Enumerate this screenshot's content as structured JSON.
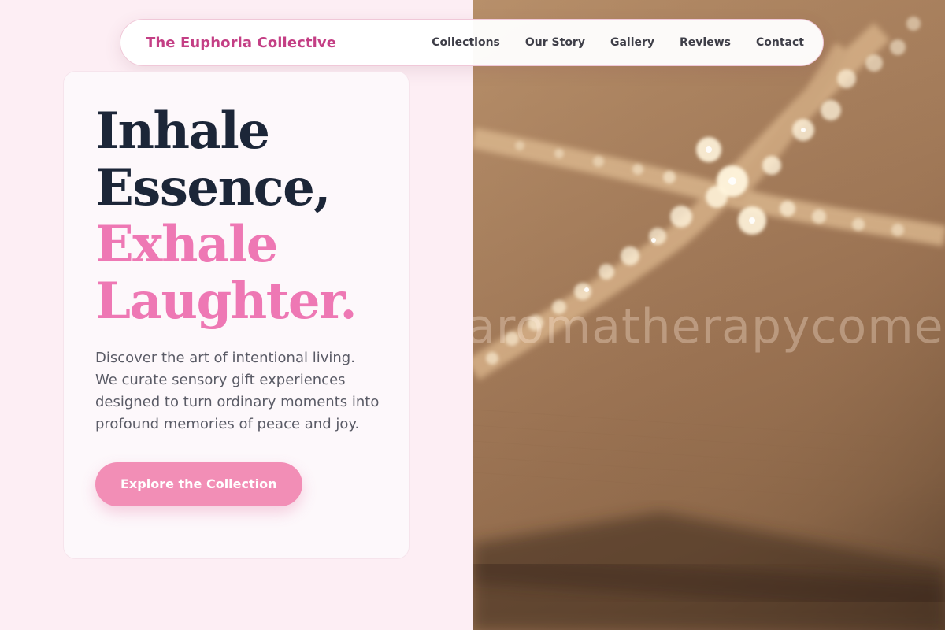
{
  "brand": {
    "name": "The Euphoria Collective",
    "color": "#c43f85"
  },
  "nav": {
    "links": [
      {
        "label": "Collections"
      },
      {
        "label": "Our Story"
      },
      {
        "label": "Gallery"
      },
      {
        "label": "Reviews"
      },
      {
        "label": "Contact"
      }
    ]
  },
  "hero": {
    "headline": {
      "line1": "Inhale",
      "line2": "Essence,",
      "line3": "Exhale",
      "line4": "Laughter."
    },
    "description": "Discover the art of intentional living. We curate sensory gift experiences designed to turn ordinary moments into profound memories of peace and joy.",
    "cta_label": "Explore the Collection"
  },
  "photo": {
    "watermark": "aromatherapycomedy.com"
  },
  "colors": {
    "page_background": "#fdeef4",
    "headline_dark": "#1c2638",
    "headline_accent": "#ee78b4",
    "button": "#f28eb6"
  }
}
